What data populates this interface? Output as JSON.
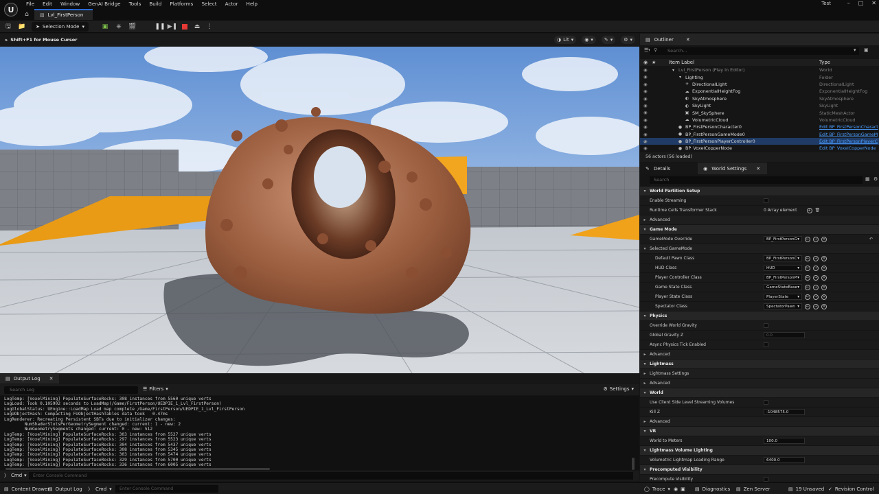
{
  "app": {
    "logo": "U",
    "menu": [
      "File",
      "Edit",
      "Window",
      "GenAI Bridge",
      "Tools",
      "Build",
      "Platforms",
      "Select",
      "Actor",
      "Help"
    ],
    "level_tab": "Lvl_FirstPerson",
    "user": "Test",
    "window_controls": [
      "–",
      "□",
      "✕"
    ]
  },
  "toolbar": {
    "selection_mode": "Selection Mode"
  },
  "viewport": {
    "hint": "Shift+F1 for Mouse Cursor",
    "view_mode": "Lit"
  },
  "output_log": {
    "tab": "Output Log",
    "search_placeholder": "Search Log",
    "filters": "Filters",
    "settings": "Settings",
    "lines": [
      "LogTemp: [VoxelMining] PopulateSurfaceRocks: 308 instances from 5560 unique verts",
      "LogLoad: Took 0.105902 seconds to LoadMap(/Game/FirstPerson/UEDPIE_1_Lvl_FirstPerson)",
      "LogGlobalStatus: UEngine::LoadMap Load map complete /Game/FirstPerson/UEDPIE_1_Lvl_FirstPerson",
      "LogUObjectHash: Compacting FUObjectHashTables data took   0.47ms",
      "LogRenderer: Recreating Persistent SBTs due to initializer changes:",
      "        NumShaderSlotsPerGeometrySegment changed: current: 1 - new: 2",
      "        NumGeometrySegments changed: current: 0 - new: 512",
      "LogTemp: [VoxelMining] PopulateSurfaceRocks: 303 instances from 5527 unique verts",
      "LogTemp: [VoxelMining] PopulateSurfaceRocks: 297 instances from 5523 unique verts",
      "LogTemp: [VoxelMining] PopulateSurfaceRocks: 304 instances from 5437 unique verts",
      "LogTemp: [VoxelMining] PopulateSurfaceRocks: 308 instances from 5345 unique verts",
      "LogTemp: [VoxelMining] PopulateSurfaceRocks: 303 instances from 5474 unique verts",
      "LogTemp: [VoxelMining] PopulateSurfaceRocks: 329 instances from 5700 unique verts",
      "LogTemp: [VoxelMining] PopulateSurfaceRocks: 336 instances from 6005 unique verts"
    ],
    "cmd_label": "Cmd",
    "cmd_placeholder": "Enter Console Command"
  },
  "statusbar": {
    "content_drawer": "Content Drawer",
    "output_log": "Output Log",
    "cmd": "Cmd",
    "cmd_placeholder": "Enter Console Command",
    "trace": "Trace",
    "diagnostics": "Diagnostics",
    "zen_server": "Zen Server",
    "unsaved": "19 Unsaved",
    "revision_control": "Revision Control"
  },
  "outliner": {
    "tab": "Outliner",
    "search_placeholder": "Search...",
    "col_label": "Item Label",
    "col_type": "Type",
    "rows": [
      {
        "indent": 0,
        "icon": "▾",
        "label": "Lvl_FirstPerson (Play In Editor)",
        "type": "World",
        "dim": true
      },
      {
        "indent": 1,
        "icon": "▾",
        "label": "Lighting",
        "type": "Folder"
      },
      {
        "indent": 2,
        "icon": "☀",
        "label": "DirectionalLight",
        "type": "DirectionalLight"
      },
      {
        "indent": 2,
        "icon": "☁",
        "label": "ExponentialHeightFog",
        "type": "ExponentialHeightFog"
      },
      {
        "indent": 2,
        "icon": "◐",
        "label": "SkyAtmosphere",
        "type": "SkyAtmosphere"
      },
      {
        "indent": 2,
        "icon": "◐",
        "label": "SkyLight",
        "type": "SkyLight"
      },
      {
        "indent": 2,
        "icon": "▣",
        "label": "SM_SkySphere",
        "type": "StaticMeshActor"
      },
      {
        "indent": 2,
        "icon": "☁",
        "label": "VolumetricCloud",
        "type": "VolumetricCloud"
      },
      {
        "indent": 1,
        "icon": "●",
        "label": "BP_FirstPersonCharacter0",
        "type": "Edit BP_FirstPersonCharact",
        "link": true
      },
      {
        "indent": 1,
        "icon": "●",
        "label": "BP_FirstPersonGameMode0",
        "type": "Edit BP_FirstPersonGameM",
        "link": true
      },
      {
        "indent": 1,
        "icon": "●",
        "label": "BP_FirstPersonPlayerController0",
        "type": "Edit BP_FirstPersonPlayerC",
        "link": true
      },
      {
        "indent": 1,
        "icon": "●",
        "label": "BP_VoxelCopperNode",
        "type": "Edit BP_VoxelCopperNode",
        "link": true
      }
    ],
    "footer": "56 actors (56 loaded)"
  },
  "details": {
    "tab_details": "Details",
    "tab_world_settings": "World Settings",
    "search_placeholder": "Search",
    "rows": [
      {
        "kind": "section",
        "label": "World Partition Setup"
      },
      {
        "kind": "prop",
        "label": "Enable Streaming",
        "ctrl": "check"
      },
      {
        "kind": "prop",
        "label": "Runtime Cells Transformer Stack",
        "ctrl": "text",
        "value": "0 Array element",
        "icons": "add"
      },
      {
        "kind": "sub",
        "label": "Advanced"
      },
      {
        "kind": "section",
        "label": "Game Mode"
      },
      {
        "kind": "prop",
        "label": "GameMode Override",
        "ctrl": "dd",
        "value": "BP_FirstPersonGar",
        "icons": "asset",
        "reset": true
      },
      {
        "kind": "sub",
        "label": "Selected GameMode"
      },
      {
        "kind": "prop",
        "label": "Default Pawn Class",
        "ctrl": "dd",
        "value": "BP_FirstPersonCha",
        "icons": "asset",
        "indent": true
      },
      {
        "kind": "prop",
        "label": "HUD Class",
        "ctrl": "dd",
        "value": "HUD",
        "icons": "asset",
        "indent": true
      },
      {
        "kind": "prop",
        "label": "Player Controller Class",
        "ctrl": "dd",
        "value": "BP_FirstPersonPla",
        "icons": "asset",
        "indent": true
      },
      {
        "kind": "prop",
        "label": "Game State Class",
        "ctrl": "dd",
        "value": "GameStateBase",
        "icons": "asset",
        "indent": true
      },
      {
        "kind": "prop",
        "label": "Player State Class",
        "ctrl": "dd",
        "value": "PlayerState",
        "icons": "asset",
        "indent": true
      },
      {
        "kind": "prop",
        "label": "Spectator Class",
        "ctrl": "dd",
        "value": "SpectatorPawn",
        "icons": "asset",
        "indent": true
      },
      {
        "kind": "section",
        "label": "Physics"
      },
      {
        "kind": "prop",
        "label": "Override World Gravity",
        "ctrl": "check"
      },
      {
        "kind": "prop",
        "label": "Global Gravity Z",
        "ctrl": "num",
        "value": "0.0",
        "dim": true
      },
      {
        "kind": "prop",
        "label": "Async Physics Tick Enabled",
        "ctrl": "check"
      },
      {
        "kind": "sub",
        "label": "Advanced"
      },
      {
        "kind": "section",
        "label": "Lightmass"
      },
      {
        "kind": "sub",
        "label": "Lightmass Settings"
      },
      {
        "kind": "sub",
        "label": "Advanced"
      },
      {
        "kind": "section",
        "label": "World"
      },
      {
        "kind": "prop",
        "label": "Use Client Side Level Streaming Volumes",
        "ctrl": "check"
      },
      {
        "kind": "prop",
        "label": "Kill Z",
        "ctrl": "num",
        "value": "-1048575.0"
      },
      {
        "kind": "sub",
        "label": "Advanced"
      },
      {
        "kind": "section",
        "label": "VR"
      },
      {
        "kind": "prop",
        "label": "World to Meters",
        "ctrl": "num",
        "value": "100.0"
      },
      {
        "kind": "section",
        "label": "Lightmass Volume Lighting"
      },
      {
        "kind": "prop",
        "label": "Volumetric Lightmap Loading Range",
        "ctrl": "num",
        "value": "6400.0"
      },
      {
        "kind": "section",
        "label": "Precomputed Visibility"
      },
      {
        "kind": "prop",
        "label": "Precompute Visibility",
        "ctrl": "check"
      }
    ]
  },
  "colors": {
    "accent": "#2a6ad8",
    "link": "#4a9dff",
    "stop": "#e53935",
    "panel_bg": "#1a1a1a",
    "ramp_orange": "#f2a51e"
  }
}
